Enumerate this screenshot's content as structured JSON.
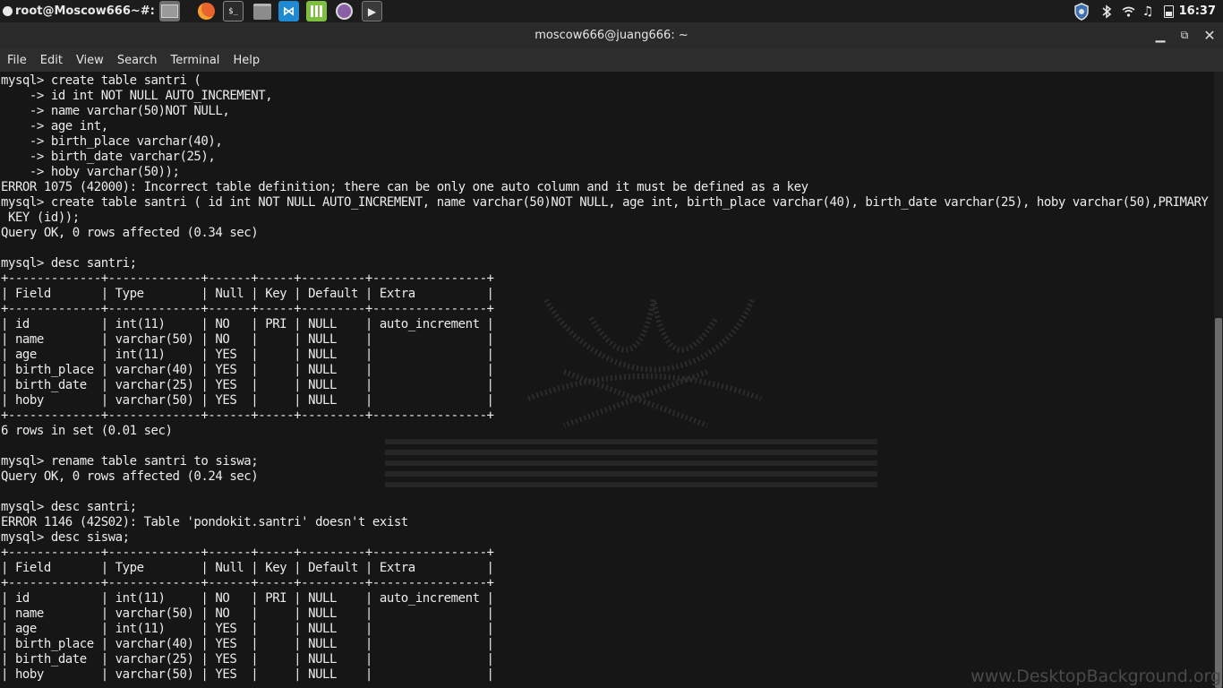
{
  "panel": {
    "user_label": "root@Moscow666~#:",
    "clock": "16:37",
    "launchers": [
      "file-manager-icon",
      "firefox-icon",
      "terminal-icon",
      "folder-icon",
      "vscode-icon",
      "calculator-icon",
      "camera-icon",
      "media-player-icon"
    ],
    "tray": [
      "security-shield-icon",
      "bluetooth-icon",
      "wifi-icon",
      "music-icon",
      "battery-icon"
    ]
  },
  "window": {
    "title": "moscow666@juang666: ~",
    "menu": [
      "File",
      "Edit",
      "View",
      "Search",
      "Terminal",
      "Help"
    ]
  },
  "terminal": {
    "lines": [
      "mysql> create table santri (",
      "    -> id int NOT NULL AUTO_INCREMENT,",
      "    -> name varchar(50)NOT NULL,",
      "    -> age int,",
      "    -> birth_place varchar(40),",
      "    -> birth_date varchar(25),",
      "    -> hoby varchar(50));",
      "ERROR 1075 (42000): Incorrect table definition; there can be only one auto column and it must be defined as a key",
      "mysql> create table santri ( id int NOT NULL AUTO_INCREMENT, name varchar(50)NOT NULL, age int, birth_place varchar(40), birth_date varchar(25), hoby varchar(50),PRIMARY",
      " KEY (id));",
      "Query OK, 0 rows affected (0.34 sec)",
      "",
      "mysql> desc santri;",
      "+-------------+-------------+------+-----+---------+----------------+",
      "| Field       | Type        | Null | Key | Default | Extra          |",
      "+-------------+-------------+------+-----+---------+----------------+",
      "| id          | int(11)     | NO   | PRI | NULL    | auto_increment |",
      "| name        | varchar(50) | NO   |     | NULL    |                |",
      "| age         | int(11)     | YES  |     | NULL    |                |",
      "| birth_place | varchar(40) | YES  |     | NULL    |                |",
      "| birth_date  | varchar(25) | YES  |     | NULL    |                |",
      "| hoby        | varchar(50) | YES  |     | NULL    |                |",
      "+-------------+-------------+------+-----+---------+----------------+",
      "6 rows in set (0.01 sec)",
      "",
      "mysql> rename table santri to siswa;",
      "Query OK, 0 rows affected (0.24 sec)",
      "",
      "mysql> desc santri;",
      "ERROR 1146 (42S02): Table 'pondokit.santri' doesn't exist",
      "mysql> desc siswa;",
      "+-------------+-------------+------+-----+---------+----------------+",
      "| Field       | Type        | Null | Key | Default | Extra          |",
      "+-------------+-------------+------+-----+---------+----------------+",
      "| id          | int(11)     | NO   | PRI | NULL    | auto_increment |",
      "| name        | varchar(50) | NO   |     | NULL    |                |",
      "| age         | int(11)     | YES  |     | NULL    |                |",
      "| birth_place | varchar(40) | YES  |     | NULL    |                |",
      "| birth_date  | varchar(25) | YES  |     | NULL    |                |",
      "| hoby        | varchar(50) | YES  |     | NULL    |                |"
    ]
  },
  "watermark": "www.DesktopBackground.org",
  "colors": {
    "terminal_bg": "#161616",
    "text": "#ececec",
    "panel_bg": "#1c1c1c",
    "titlebar_bg": "#2a2a2a",
    "menubar_bg": "#2d2d2d",
    "firefox": "#e8642c",
    "vscode": "#1f8ad2",
    "calculator": "#7fbf3f"
  }
}
